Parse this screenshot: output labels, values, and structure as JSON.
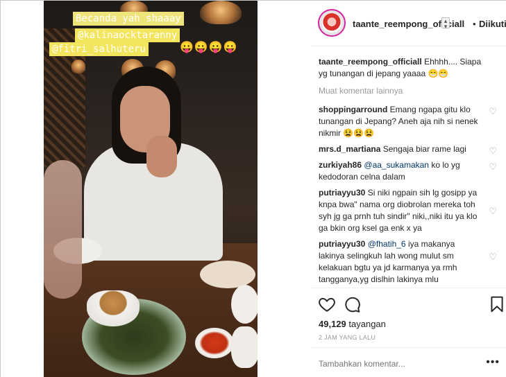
{
  "story": {
    "line1": "Becanda yah shaaay",
    "line2": "@kalinaocktaranny",
    "line3": "@fitri_salhuteru",
    "emojis": "😛😛😛😛"
  },
  "header": {
    "username": "taante_reempong_officiall",
    "separator": "•",
    "follow_label": "Diikuti"
  },
  "caption": {
    "user": "taante_reempong_officiall",
    "text": "Ehhhh.... Siapa yg tunangan di jepang yaaaa 😁😁"
  },
  "load_more": "Muat komentar lainnya",
  "comments": [
    {
      "user": "shoppingarround",
      "text": "Emang ngapa gitu klo tunangan di Jepang? Aneh aja nih si nenek nikmir 😫😫😫"
    },
    {
      "user": "mrs.d_martiana",
      "text": "Sengaja biar rame lagi"
    },
    {
      "user": "zurkiyah86",
      "mention": "@aa_sukamakan",
      "text": "ko lo yg kedodoran celna dalam"
    },
    {
      "user": "putriayyu30",
      "text": "Si niki ngpain sih lg gosipp ya knpa bwa\" nama org diobrolan mereka toh syh jg ga prnh tuh sindir\" niki,,niki itu ya klo ga bkin org ksel ga enk x ya"
    },
    {
      "user": "putriayyu30",
      "mention": "@fhatih_6",
      "text": "iya makanya lakinya selingkuh lah wong mulut sm kelakuan bgtu ya jd karmanya ya rmh tangganya,yg dislhin lakinya mlu"
    }
  ],
  "stats": {
    "views_count": "49,129",
    "views_label": "tayangan",
    "time": "2 JAM YANG LALU"
  },
  "add_comment": {
    "placeholder": "Tambahkan komentar...",
    "more": "•••"
  },
  "icons": {
    "like": "heart-icon",
    "comment": "comment-icon",
    "save": "bookmark-icon"
  }
}
